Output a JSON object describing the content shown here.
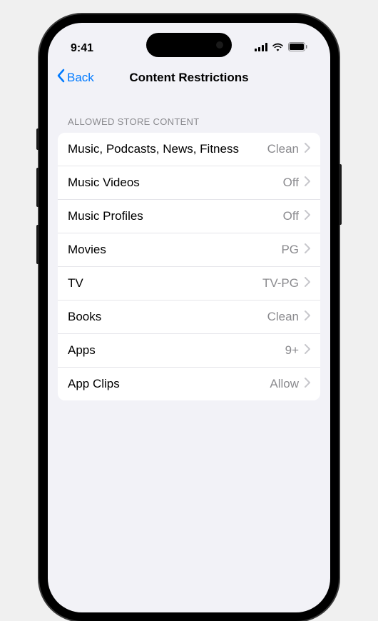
{
  "status": {
    "time": "9:41"
  },
  "nav": {
    "back_label": "Back",
    "title": "Content Restrictions"
  },
  "section": {
    "header": "ALLOWED STORE CONTENT",
    "rows": [
      {
        "label": "Music, Podcasts, News, Fitness",
        "value": "Clean"
      },
      {
        "label": "Music Videos",
        "value": "Off"
      },
      {
        "label": "Music Profiles",
        "value": "Off"
      },
      {
        "label": "Movies",
        "value": "PG"
      },
      {
        "label": "TV",
        "value": "TV-PG"
      },
      {
        "label": "Books",
        "value": "Clean"
      },
      {
        "label": "Apps",
        "value": "9+"
      },
      {
        "label": "App Clips",
        "value": "Allow"
      }
    ]
  }
}
